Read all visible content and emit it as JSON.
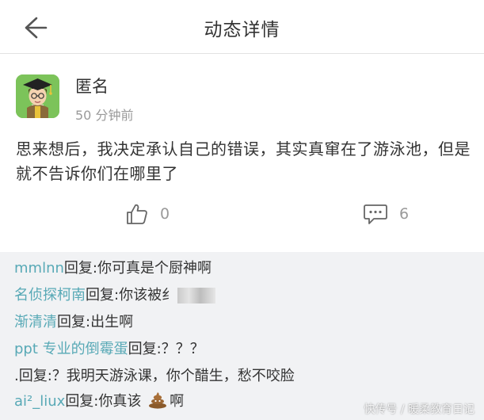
{
  "header": {
    "title": "动态详情"
  },
  "post": {
    "author": "匿名",
    "time": "50 分钟前",
    "content": "思来想后，我决定承认自己的错误，其实真窜在了游泳池，但是就不告诉你们在哪里了",
    "like_count": "0",
    "comment_count": "6"
  },
  "replies": [
    {
      "user": "mmlnn",
      "sep": "回复:",
      "text": "你可真是个厨神啊"
    },
    {
      "user": "名侦探柯南",
      "sep": "回复:",
      "text": "你该被纟"
    },
    {
      "user": "渐清清",
      "sep": "回复:",
      "text": "出生啊"
    },
    {
      "user": "ppt 专业的倒霉蛋",
      "sep": "回复:",
      "text": "？？？"
    },
    {
      "user": ".",
      "sep": "回复:",
      "text": "？我明天游泳课，你个醋生，愁不咬脸"
    },
    {
      "user": "ai²_liux",
      "sep": "回复:",
      "text": "你真该",
      "text_after": "啊"
    }
  ],
  "watermark": "快传号 / 暖柔教育日记",
  "icons": {
    "back": "arrow-left-icon",
    "like": "thumbs-up-icon",
    "comment": "comment-bubble-icon",
    "poop": "poop-emoji-icon"
  },
  "colors": {
    "reply_user": "#58a9b6",
    "reply_bg": "#f1f2f4",
    "avatar_bg": "#7cc35a"
  }
}
